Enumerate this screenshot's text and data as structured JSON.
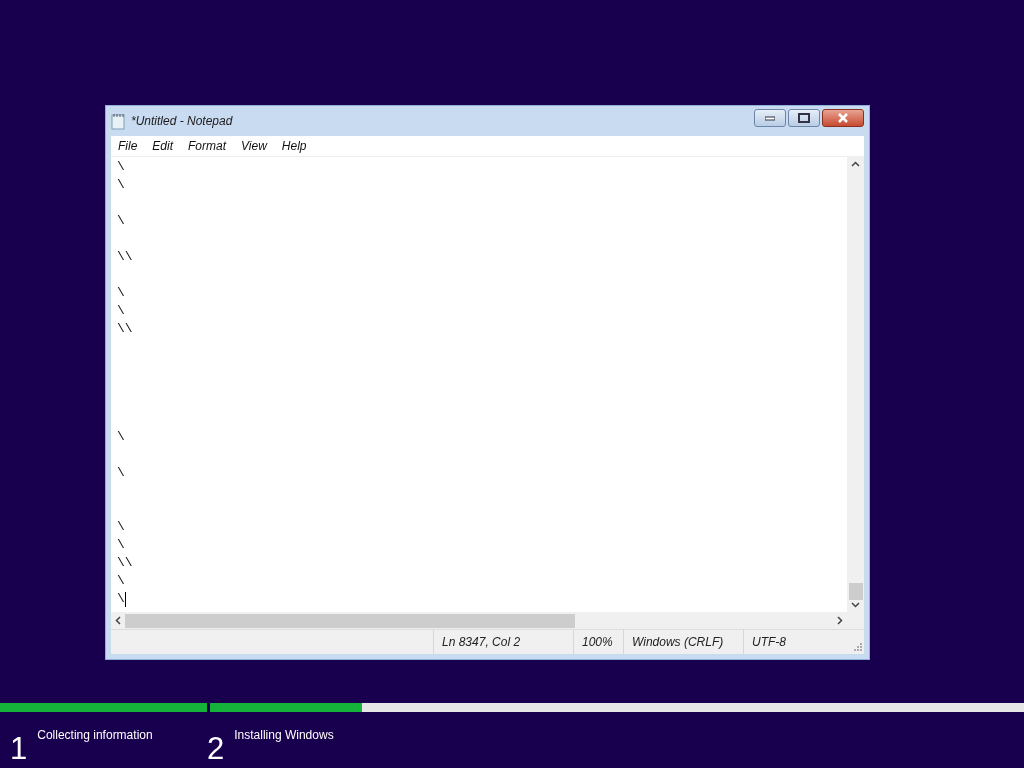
{
  "window": {
    "title": "*Untitled - Notepad"
  },
  "menu": [
    "File",
    "Edit",
    "Format",
    "View",
    "Help"
  ],
  "editor": {
    "lines": [
      {
        "kind": "text",
        "text": "\\",
        "caret": false
      },
      {
        "kind": "text",
        "text": "\\",
        "caret": false
      },
      {
        "kind": "blank",
        "caret": false
      },
      {
        "kind": "text",
        "text": "\\",
        "caret": false
      },
      {
        "kind": "blank",
        "caret": false
      },
      {
        "kind": "text",
        "text": "\\\\",
        "caret": false
      },
      {
        "kind": "blank",
        "caret": false
      },
      {
        "kind": "text",
        "text": "\\",
        "caret": false
      },
      {
        "kind": "text",
        "text": "\\",
        "caret": false
      },
      {
        "kind": "text",
        "text": "\\\\",
        "caret": false
      },
      {
        "kind": "blank",
        "caret": false
      },
      {
        "kind": "blank",
        "caret": false
      },
      {
        "kind": "blank",
        "caret": false
      },
      {
        "kind": "blank",
        "caret": false
      },
      {
        "kind": "blank",
        "caret": false
      },
      {
        "kind": "text",
        "text": "\\",
        "caret": false
      },
      {
        "kind": "blank",
        "caret": false
      },
      {
        "kind": "text",
        "text": "\\",
        "caret": false
      },
      {
        "kind": "blank",
        "caret": false
      },
      {
        "kind": "blank",
        "caret": false
      },
      {
        "kind": "text",
        "text": "\\",
        "caret": false
      },
      {
        "kind": "text",
        "text": "\\",
        "caret": false
      },
      {
        "kind": "text",
        "text": "\\\\",
        "caret": false
      },
      {
        "kind": "text",
        "text": "\\",
        "caret": false
      },
      {
        "kind": "text",
        "text": "\\",
        "caret": true
      }
    ]
  },
  "status_bar": [
    "Ln 8347, Col 2",
    "100%",
    "Windows (CRLF)",
    "UTF-8"
  ],
  "setup_steps": [
    {
      "number": "1",
      "label": "Collecting information",
      "level": 1
    },
    {
      "number": "2",
      "label": "Installing Windows",
      "level": 0.187
    }
  ]
}
